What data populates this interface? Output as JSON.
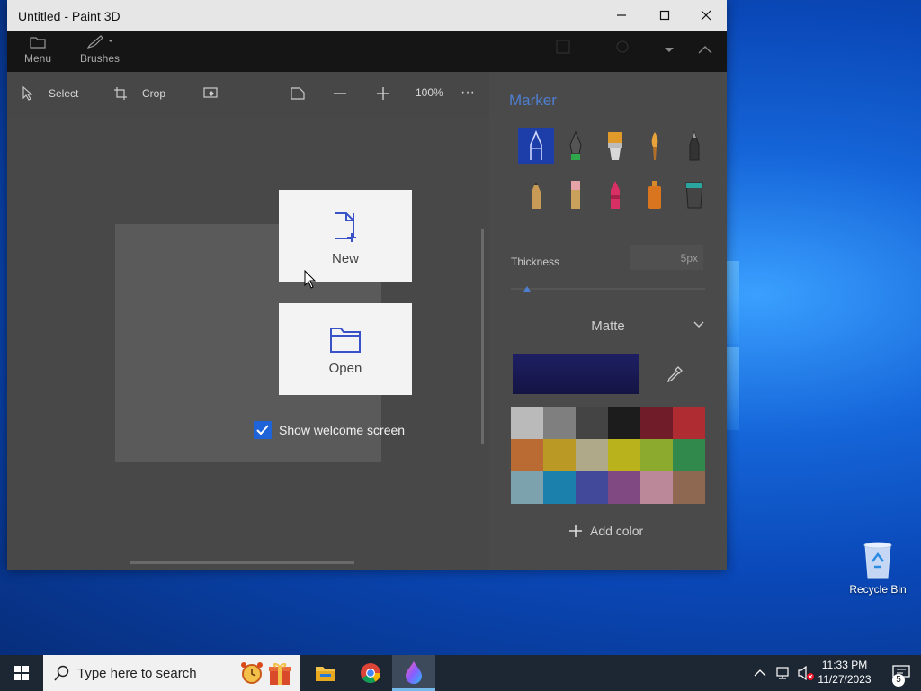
{
  "window": {
    "title": "Untitled - Paint 3D",
    "minimize_icon": "minimize-icon",
    "maximize_icon": "maximize-icon",
    "close_icon": "close-icon"
  },
  "ribbon": {
    "menu_label": "Menu",
    "brushes_label": "Brushes"
  },
  "toolbar": {
    "select_label": "Select",
    "crop_label": "Crop",
    "zoom": "100%",
    "more": "···"
  },
  "panel": {
    "title": "Marker",
    "thickness_label": "Thickness",
    "thickness_value": "5px",
    "thickness_level": 0.05,
    "finish": "Matte",
    "current_color": "#1e1f63",
    "palette": [
      "#ffffff",
      "#a0a0a0",
      "#404040",
      "#000000",
      "#880015",
      "#ed1c24",
      "#ff7f27",
      "#ffc90e",
      "#efe4b0",
      "#fff200",
      "#b5e61d",
      "#22b14c",
      "#99d9ea",
      "#00a2e8",
      "#3f48cc",
      "#a349a4",
      "#ffaec9",
      "#b97a57"
    ],
    "add_color_label": "Add color"
  },
  "welcome": {
    "new_label": "New",
    "open_label": "Open",
    "show_welcome_label": "Show welcome screen",
    "show_welcome_checked": true
  },
  "desktop": {
    "recycle_bin_label": "Recycle Bin"
  },
  "taskbar": {
    "search_placeholder": "Type here to search",
    "time": "11:33 PM",
    "date": "11/27/2023",
    "notification_count": "5"
  },
  "colors": {
    "accent": "#1f63d8",
    "panel_title": "#4e7fd0"
  }
}
